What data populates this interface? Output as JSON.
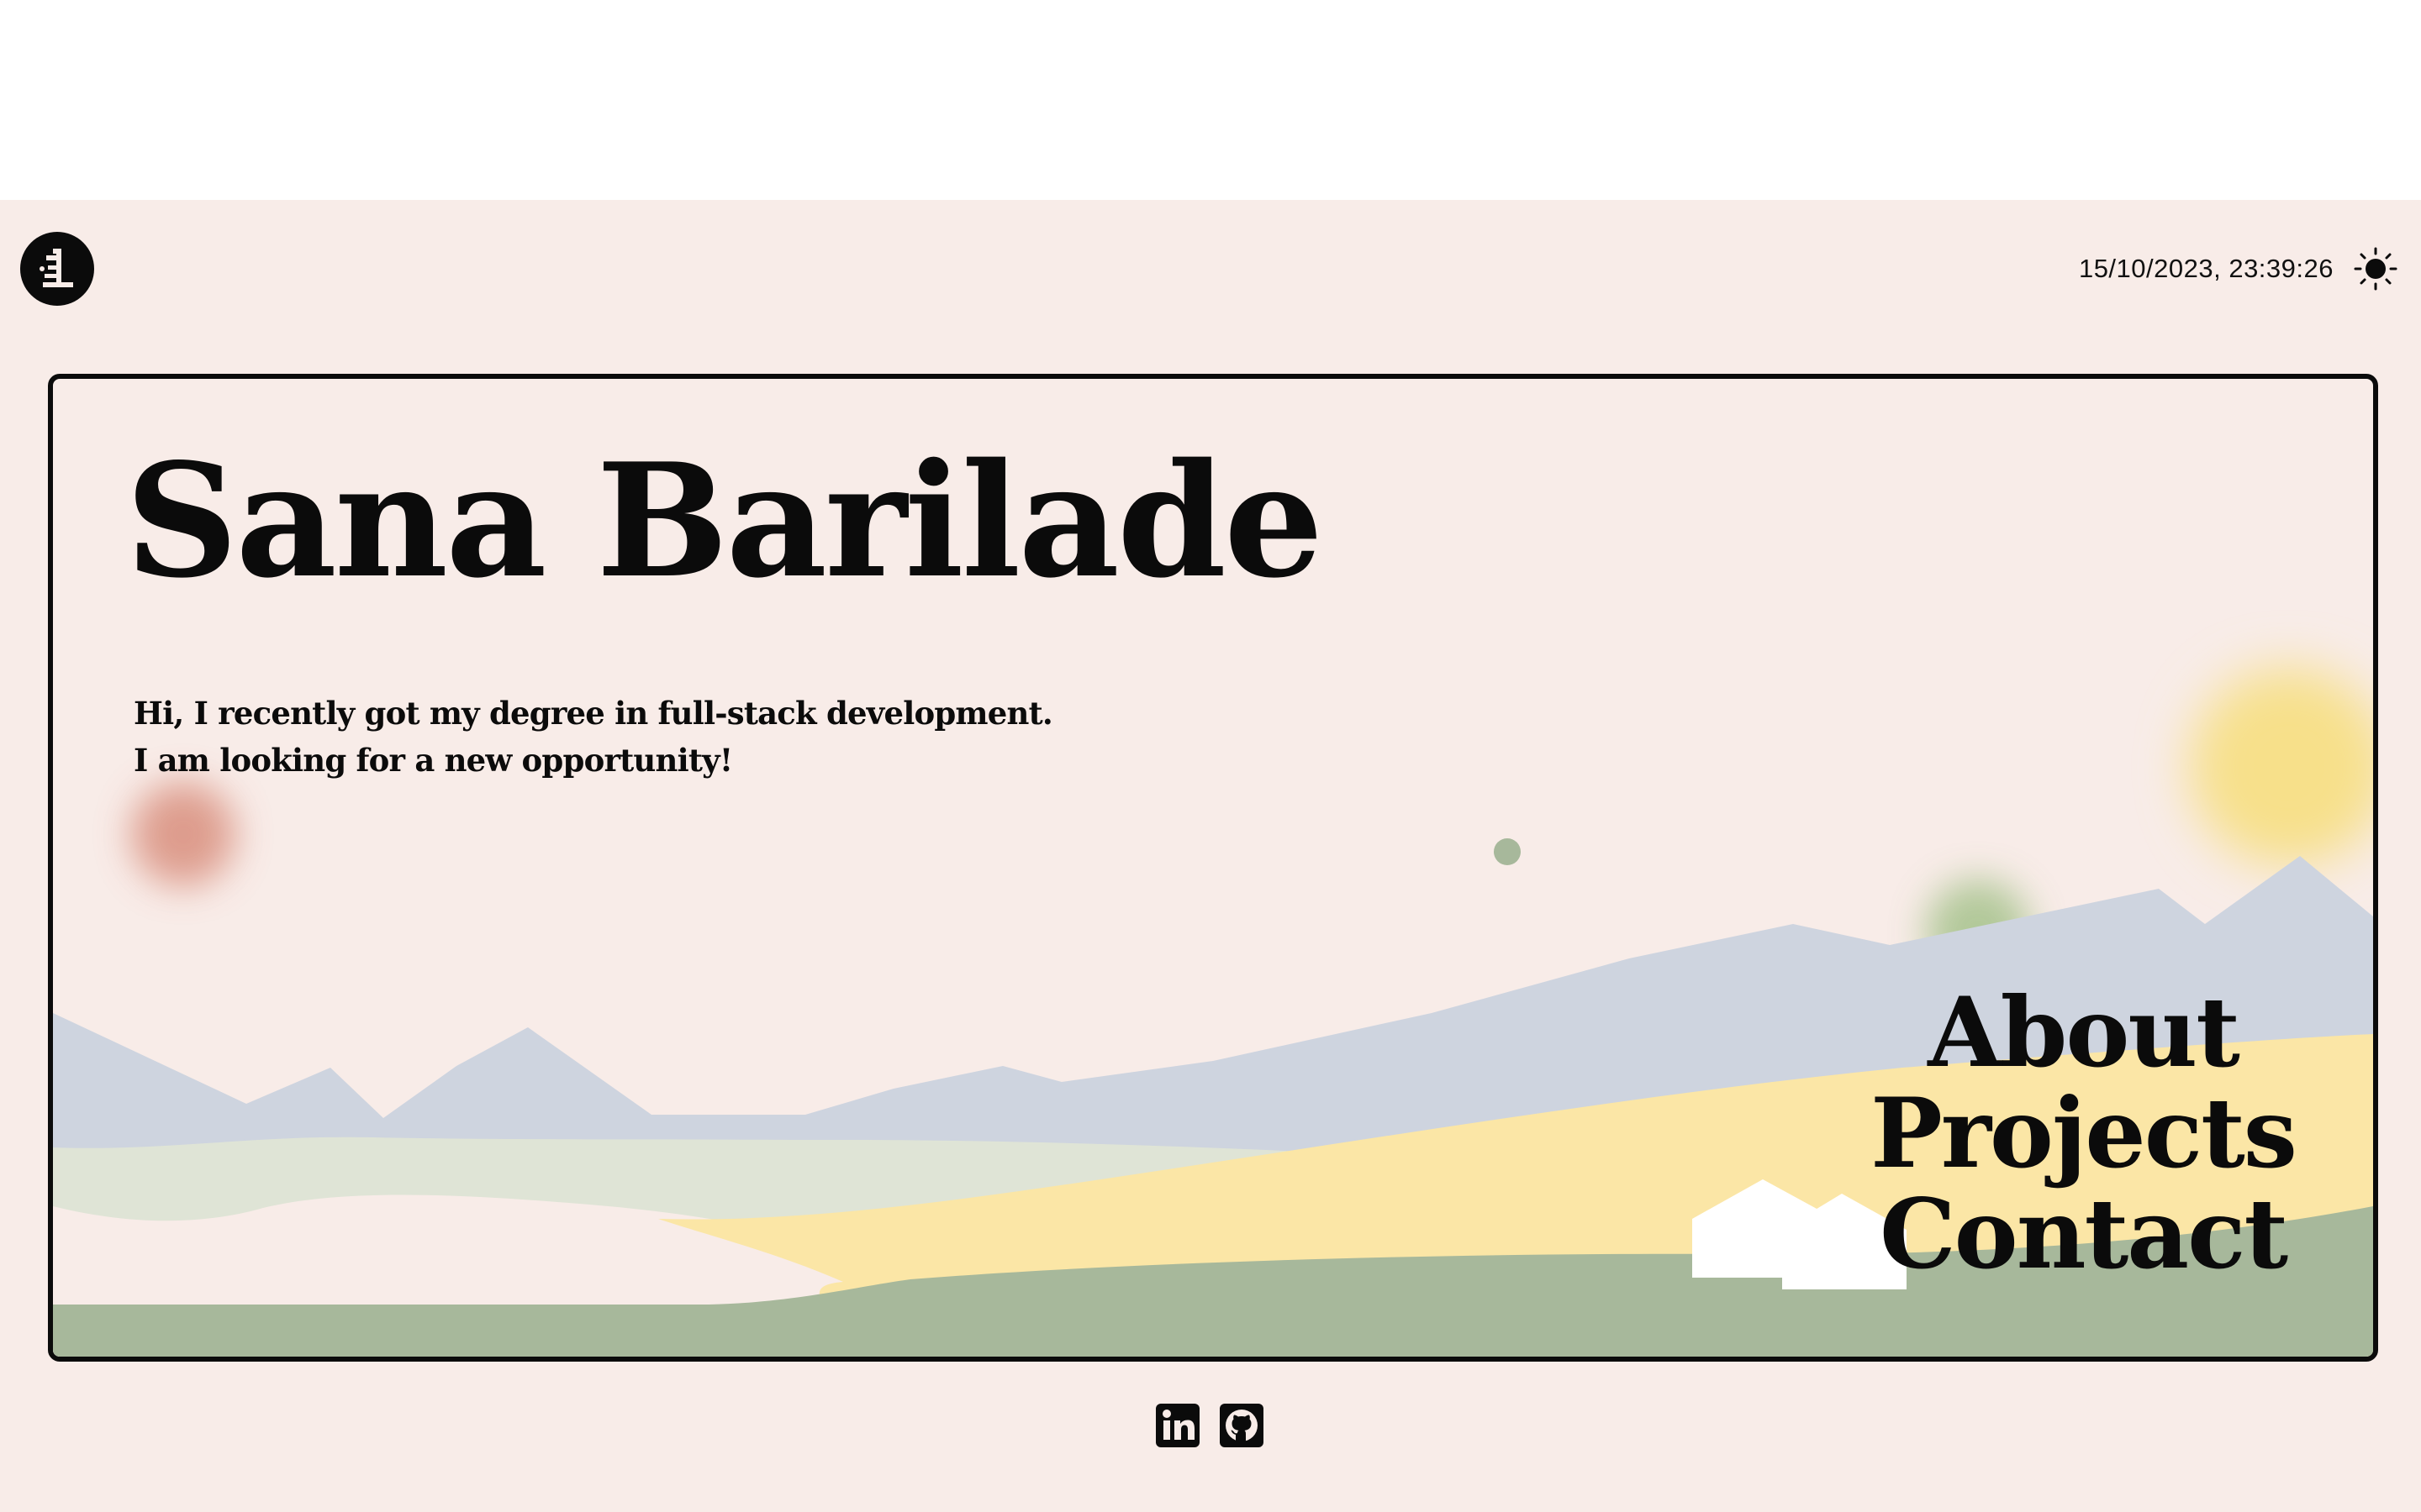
{
  "header": {
    "datetime": "15/10/2023, 23:39:26",
    "logo_icon": "monogram-logo-icon",
    "theme_icon": "sun-icon"
  },
  "hero": {
    "name": "Sana Barilade",
    "intro_line1": "Hi, I recently got my degree in full-stack development.",
    "intro_line2": "I am looking for a new opportunity!"
  },
  "nav": {
    "about": "About",
    "projects": "Projects",
    "contact": "Contact"
  },
  "social": {
    "items": [
      "linkedin-icon",
      "github-icon"
    ]
  },
  "colors": {
    "background": "#f8ece8",
    "ink": "#0b0b0b",
    "mountains": "#ced4df",
    "pale_green": "#dfe4d6",
    "yellow_field": "#fbe6a6",
    "green_ground": "#a7b89b",
    "sun": "#f7e08a",
    "red_orb": "#d98f7e",
    "green_orb": "#a6c28c"
  }
}
